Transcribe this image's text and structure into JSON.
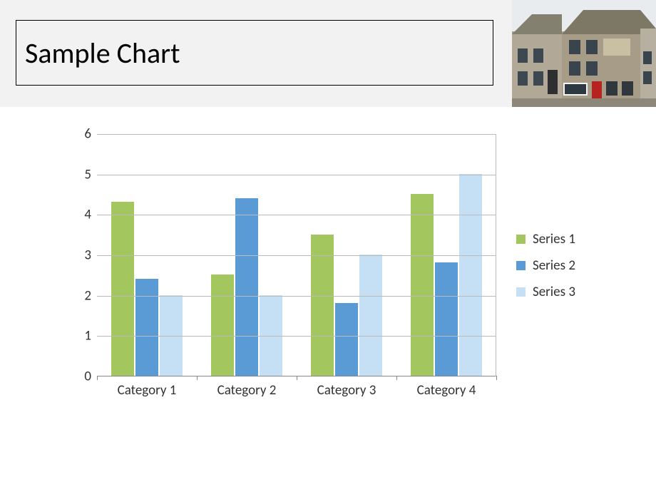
{
  "header": {
    "title": "Sample Chart"
  },
  "chart_data": {
    "type": "bar",
    "title": "",
    "xlabel": "",
    "ylabel": "",
    "ylim": [
      0,
      6
    ],
    "yticks": [
      0,
      1,
      2,
      3,
      4,
      5,
      6
    ],
    "categories": [
      "Category 1",
      "Category 2",
      "Category 3",
      "Category 4"
    ],
    "series": [
      {
        "name": "Series 1",
        "color": "#a4c65e",
        "values": [
          4.3,
          2.5,
          3.5,
          4.5
        ]
      },
      {
        "name": "Series 2",
        "color": "#5b9bd5",
        "values": [
          2.4,
          4.4,
          1.8,
          2.8
        ]
      },
      {
        "name": "Series 3",
        "color": "#c5e0f5",
        "values": [
          2.0,
          2.0,
          3.0,
          5.0
        ]
      }
    ],
    "legend_position": "right",
    "grid": true
  }
}
